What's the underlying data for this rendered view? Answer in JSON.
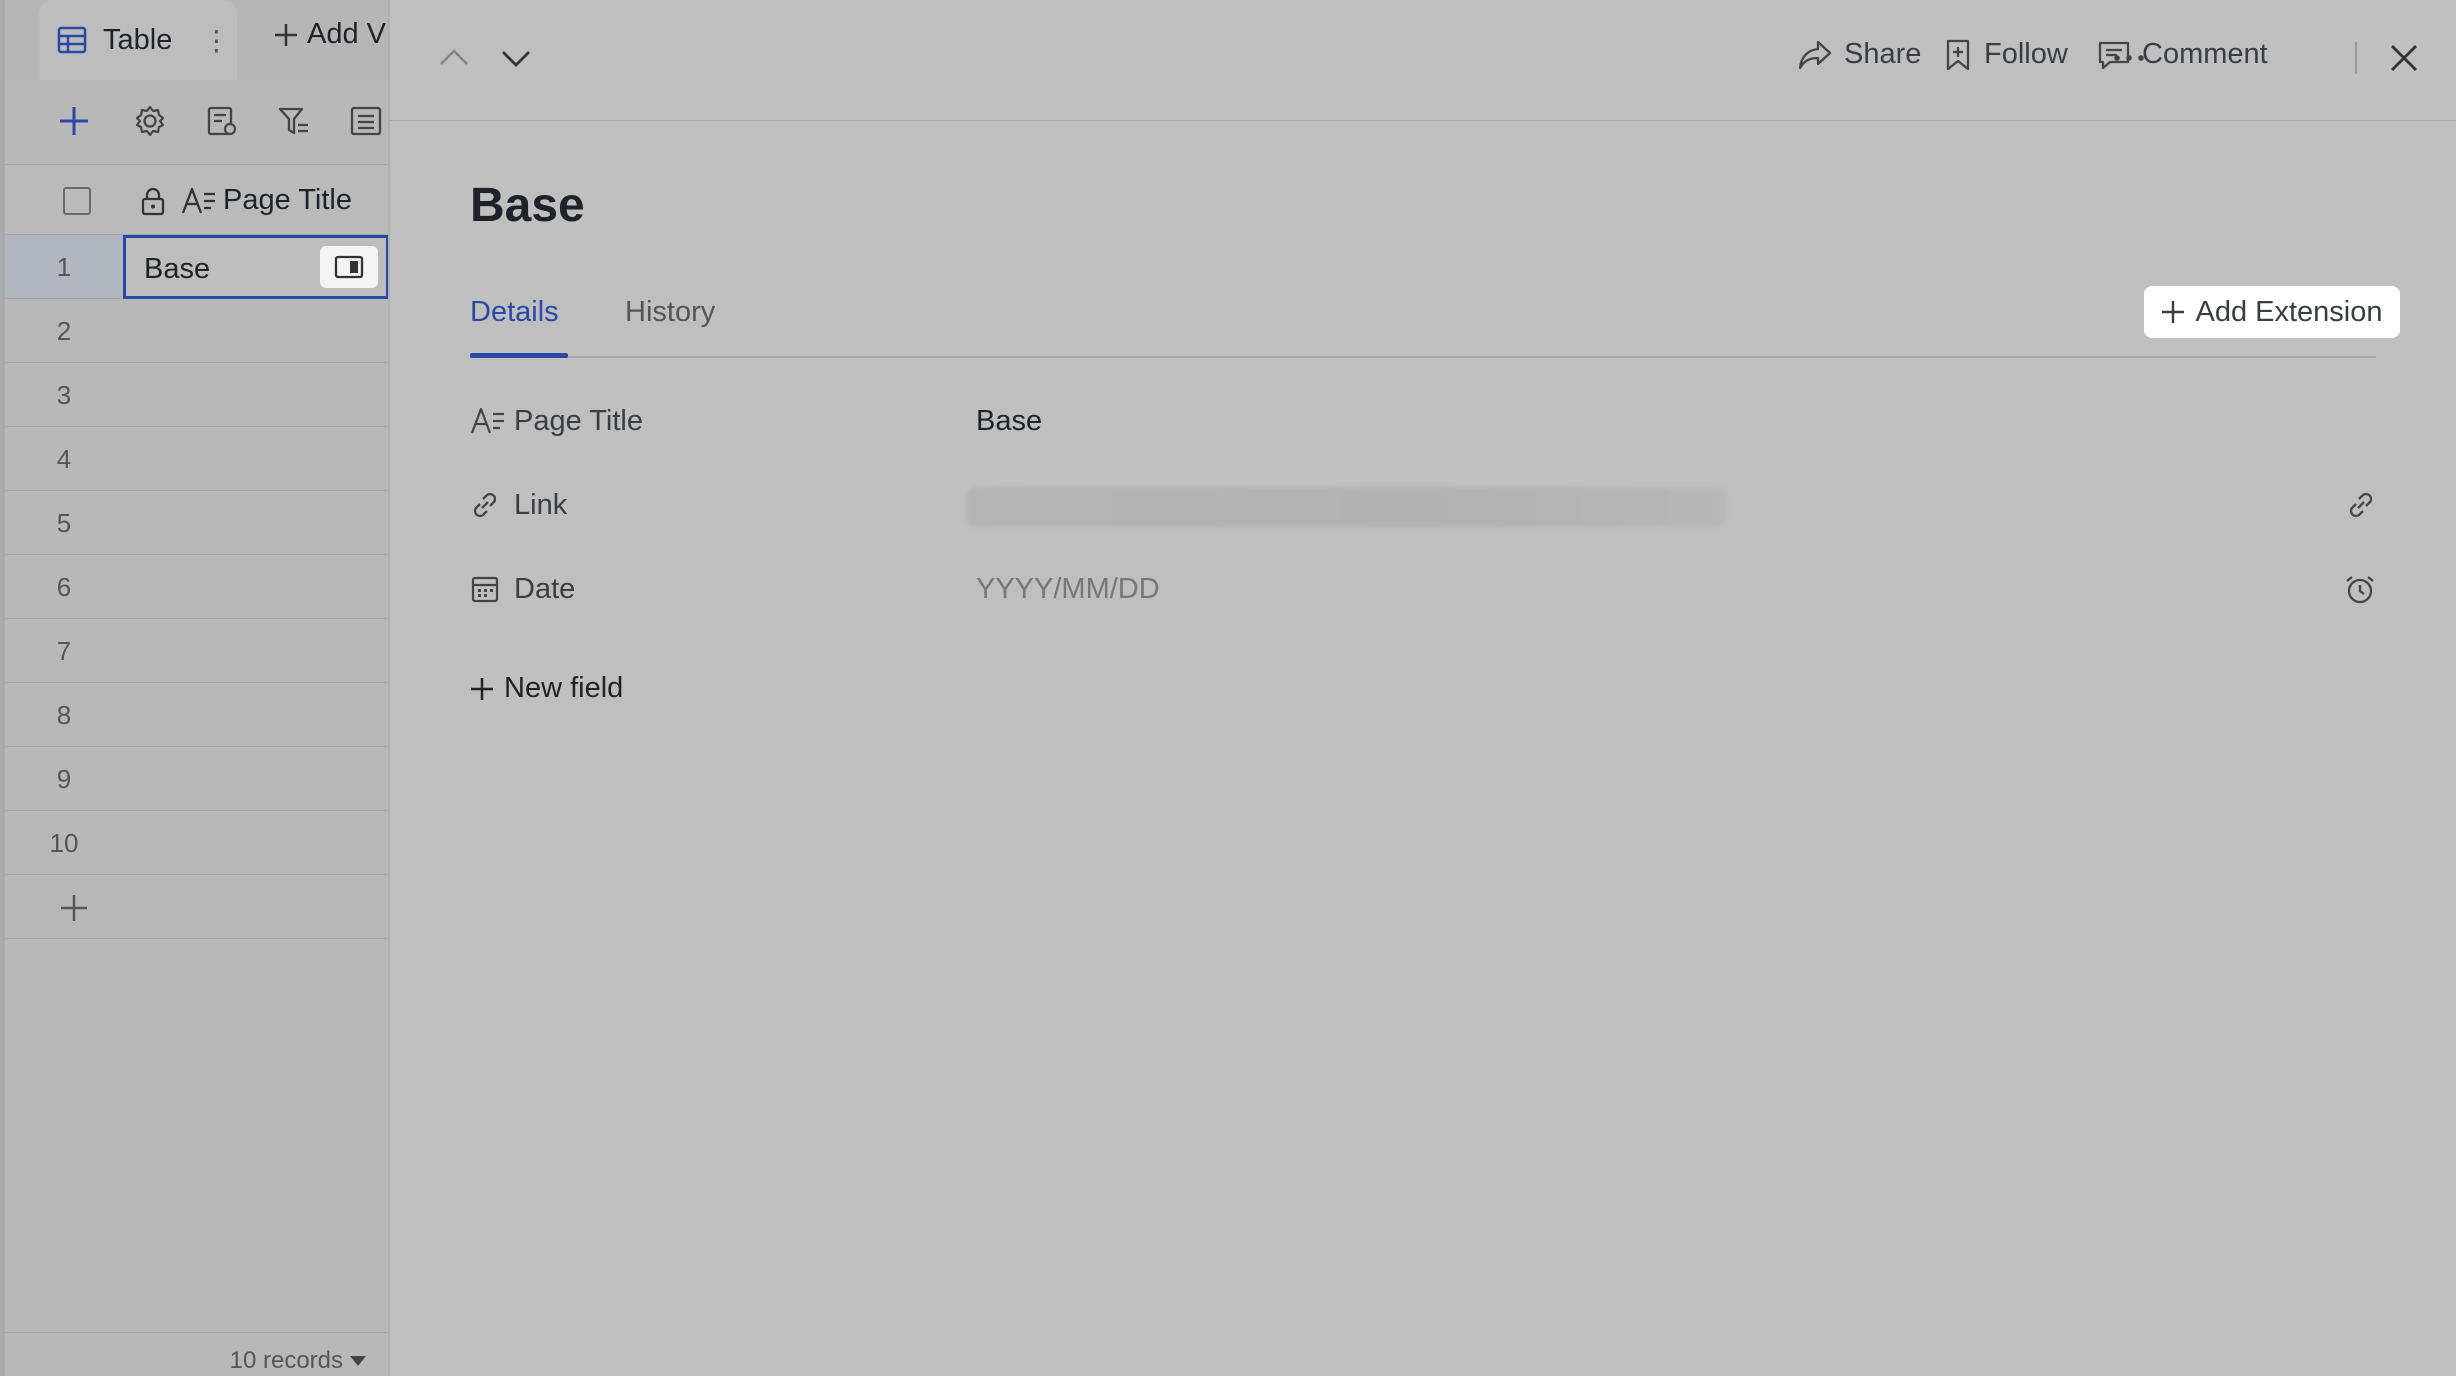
{
  "grid": {
    "view_tab_label": "Table",
    "add_view_label": "Add V",
    "column_title": "Page Title",
    "rows": [
      {
        "num": "1",
        "value": "Base"
      },
      {
        "num": "2",
        "value": ""
      },
      {
        "num": "3",
        "value": ""
      },
      {
        "num": "4",
        "value": ""
      },
      {
        "num": "5",
        "value": ""
      },
      {
        "num": "6",
        "value": ""
      },
      {
        "num": "7",
        "value": ""
      },
      {
        "num": "8",
        "value": ""
      },
      {
        "num": "9",
        "value": ""
      },
      {
        "num": "10",
        "value": ""
      }
    ],
    "records_label": "10 records"
  },
  "detail": {
    "header": {
      "share_label": "Share",
      "follow_label": "Follow",
      "comment_label": "Comment"
    },
    "title": "Base",
    "tabs": [
      {
        "label": "Details",
        "active": true
      },
      {
        "label": "History",
        "active": false
      }
    ],
    "add_extension_label": "Add Extension",
    "fields": [
      {
        "label": "Page Title",
        "value": "Base",
        "icon": "text-field-icon"
      },
      {
        "label": "Link",
        "value": "",
        "icon": "link-icon"
      },
      {
        "label": "Date",
        "placeholder": "YYYY/MM/DD",
        "icon": "calendar-icon"
      }
    ],
    "new_field_label": "New field"
  },
  "colors": {
    "accent": "#2a48a6",
    "overlay": "#bfbfbf",
    "text": "#1f2329"
  }
}
